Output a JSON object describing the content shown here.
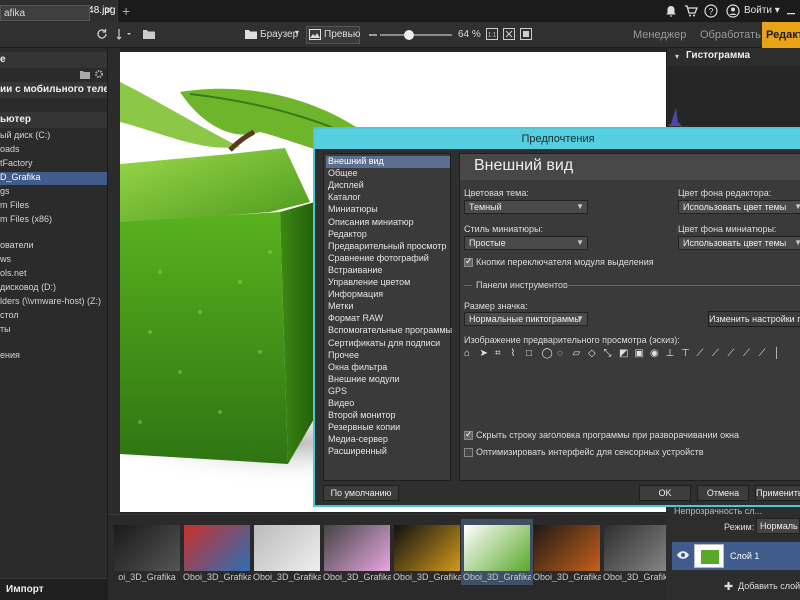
{
  "titlebar": {
    "tab_title": "oi_3D_Grafika_58_48.jpg",
    "new_tab": "+",
    "close": "✕",
    "signin": "Войти ▾"
  },
  "toolbar": {
    "search_value": "afika",
    "browser_label": "Браузер",
    "preview_label": "Превью",
    "zoom": "64 %",
    "slider_level": 0.4
  },
  "modes": {
    "manager": "Менеджер",
    "process": "Обработать",
    "edit": "Редакт"
  },
  "left_panel": {
    "items": [
      {
        "label": "е",
        "type": "head"
      },
      {
        "label": "",
        "type": "blank"
      },
      {
        "label": "ии с мобильного теле...",
        "type": "head"
      },
      {
        "label": "",
        "type": "blank"
      },
      {
        "label": "ьютер",
        "type": "head"
      },
      {
        "label": "ый диск (C:)",
        "type": "item"
      },
      {
        "label": "oads",
        "type": "item"
      },
      {
        "label": "tFactory",
        "type": "item"
      },
      {
        "label": "D_Grafika",
        "type": "sel"
      },
      {
        "label": "gs",
        "type": "item"
      },
      {
        "label": "m Files",
        "type": "item"
      },
      {
        "label": "m Files (x86)",
        "type": "item"
      },
      {
        "label": "",
        "type": "blank"
      },
      {
        "label": "ователи",
        "type": "item"
      },
      {
        "label": "ws",
        "type": "item"
      },
      {
        "label": "ols.net",
        "type": "item"
      },
      {
        "label": "дисковод (D:)",
        "type": "item"
      },
      {
        "label": "lders (\\\\vmware-host) (Z:)",
        "type": "item"
      },
      {
        "label": "стол",
        "type": "item"
      },
      {
        "label": "ты",
        "type": "item"
      },
      {
        "label": "",
        "type": "blank"
      },
      {
        "label": "ения",
        "type": "item"
      }
    ],
    "import_label": "Импорт"
  },
  "filmstrip": {
    "items": [
      {
        "caption": "oi_3D_Grafika",
        "colors": [
          "#1a1a1a",
          "#555"
        ]
      },
      {
        "caption": "Oboi_3D_Grafika",
        "colors": [
          "#c9302c",
          "#2b6fb5"
        ]
      },
      {
        "caption": "Oboi_3D_Grafika",
        "colors": [
          "#bbbbbb",
          "#eeeeee"
        ]
      },
      {
        "caption": "Oboi_3D_Grafika",
        "colors": [
          "#444",
          "#e7a6e0"
        ]
      },
      {
        "caption": "Oboi_3D_Grafika",
        "colors": [
          "#111",
          "#d29a1c"
        ]
      },
      {
        "caption": "Oboi_3D_Grafika",
        "colors": [
          "#ffffff",
          "#5aa72a"
        ],
        "selected": true
      },
      {
        "caption": "Oboi_3D_Grafika",
        "colors": [
          "#1f1a16",
          "#c65f1c"
        ]
      },
      {
        "caption": "Oboi_3D_Grafika",
        "colors": [
          "#2e2e2e",
          "#888"
        ]
      },
      {
        "caption": "Oboi_3D_Grafika",
        "colors": [
          "#5a8a2a",
          "#a2d45a"
        ]
      }
    ]
  },
  "right_panel": {
    "histogram_title": "Гистограмма",
    "opacity_label": "Непрозрачность сл...",
    "mode_label": "Режим:",
    "mode_value": "Нормаль",
    "layer_name": "Слой 1",
    "add_layer": "Добавить слой"
  },
  "dialog": {
    "title": "Предпочтения",
    "header": "Внешний вид",
    "categories": [
      "Внешний вид",
      "Общее",
      "Дисплей",
      "Каталог",
      "Миниатюры",
      "Описания миниатюр",
      "Редактор",
      "Предварительный просмотр",
      "Сравнение фотографий",
      "Встраивание",
      "Управление цветом",
      "Информация",
      "Метки",
      "Формат RAW",
      "Вспомогательные программы",
      "Сертификаты для подписи",
      "Прочее",
      "Окна фильтра",
      "Внешние модули",
      "GPS",
      "Видео",
      "Второй монитор",
      "Резервные копии",
      "Медиа-сервер",
      "Расширенный"
    ],
    "color_theme_label": "Цветовая тема:",
    "color_theme_value": "Темный",
    "editor_bg_label": "Цвет фона редактора:",
    "editor_bg_value": "Использовать цвет темы",
    "thumb_style_label": "Стиль миниатюры:",
    "thumb_style_value": "Простые",
    "thumb_bg_label": "Цвет фона миниатюры:",
    "thumb_bg_value": "Использовать цвет темы",
    "module_switch_label": "Кнопки переключателя модуля выделения",
    "toolbars_label": "Панели инструментов",
    "icon_size_label": "Размер значка:",
    "icon_size_value": "Нормальные пиктограммы",
    "change_settings_btn": "Изменить настройки пан",
    "preview_image_label": "Изображение предварительного просмотра (эскиз):",
    "hide_titlebar_label": "Скрыть строку заголовка программы при разворачивании окна",
    "optimize_touch_label": "Оптимизировать интерфейс для сенсорных устройств",
    "default_btn": "По умолчанию",
    "ok_btn": "OK",
    "cancel_btn": "Отмена",
    "apply_btn": "Применить"
  }
}
